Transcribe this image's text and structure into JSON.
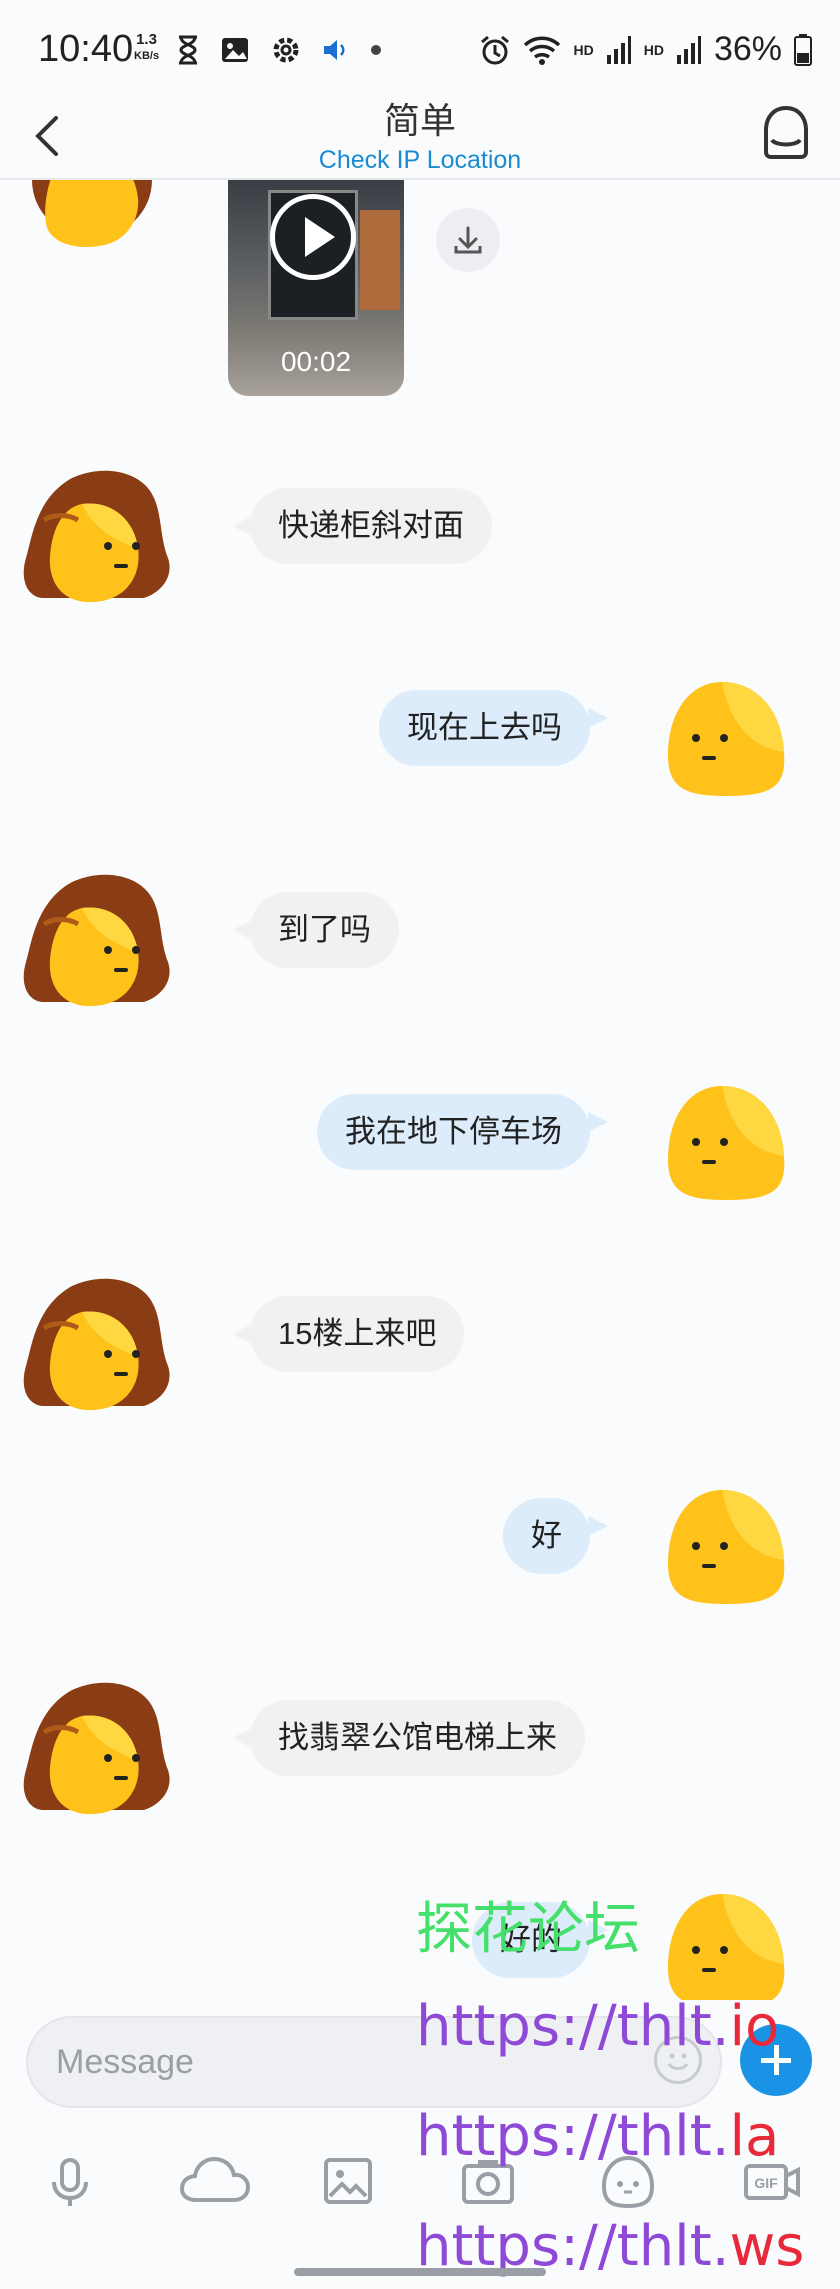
{
  "status_bar": {
    "time": "10:40",
    "speed_value": "1.3",
    "speed_unit": "KB/s",
    "hd1": "HD",
    "hd2": "HD",
    "battery": "36%"
  },
  "header": {
    "title": "简单",
    "subtitle": "Check IP Location"
  },
  "video": {
    "duration": "00:02"
  },
  "messages": [
    {
      "side": "in",
      "text": "快递柜斜对面"
    },
    {
      "side": "out",
      "text": "现在上去吗"
    },
    {
      "side": "in",
      "text": "到了吗"
    },
    {
      "side": "out",
      "text": "我在地下停车场"
    },
    {
      "side": "in",
      "text": "15楼上来吧"
    },
    {
      "side": "out",
      "text": "好"
    },
    {
      "side": "in",
      "text": "找翡翠公馆电梯上来"
    },
    {
      "side": "out",
      "text": "好的"
    }
  ],
  "watermark": {
    "title": "探花论坛",
    "url1_prefix": "https://thlt.",
    "url1_suffix": "io",
    "url2_prefix": "https://thlt.",
    "url2_suffix": "la",
    "url3_prefix": "https://thlt.",
    "url3_suffix": "ws"
  },
  "composer": {
    "placeholder": "Message",
    "tools": [
      "microphone-icon",
      "cloud-icon",
      "image-icon",
      "camera-icon",
      "sticker-icon",
      "gif-icon"
    ],
    "gif_label": "GIF"
  },
  "colors": {
    "accent": "#1a93e6",
    "link": "#1a8ad1",
    "incoming_bubble": "#f0f1f3",
    "outgoing_bubble": "#dcecfb",
    "watermark_green": "#45e06b",
    "watermark_purple": "#8e4ad6",
    "watermark_red": "#e8293a"
  }
}
